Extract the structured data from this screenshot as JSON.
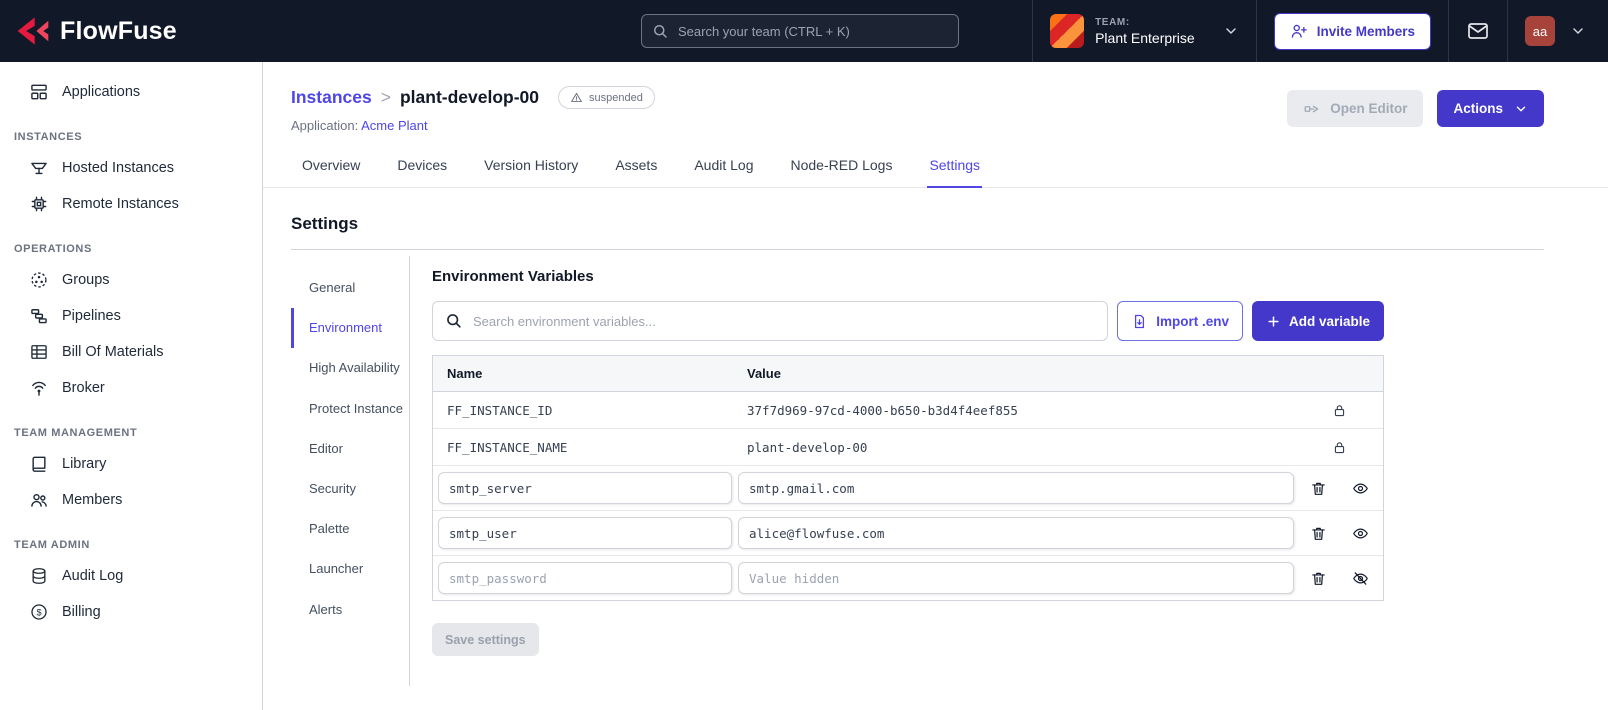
{
  "theme": {
    "header-bg": "#111827",
    "accent": "#4338ca",
    "link": "#4f46e5",
    "brand-red": "#e51a3f",
    "avatar-bg": "#a8433c"
  },
  "header": {
    "brand": "FlowFuse",
    "search_placeholder": "Search your team (CTRL + K)",
    "team_label": "TEAM:",
    "team_name": "Plant Enterprise",
    "invite_label": "Invite Members",
    "avatar": "aa"
  },
  "sidebar": {
    "sections": [
      {
        "label": "",
        "items": [
          "Applications"
        ]
      },
      {
        "label": "INSTANCES",
        "items": [
          "Hosted Instances",
          "Remote Instances"
        ]
      },
      {
        "label": "OPERATIONS",
        "items": [
          "Groups",
          "Pipelines",
          "Bill Of Materials",
          "Broker"
        ]
      },
      {
        "label": "TEAM MANAGEMENT",
        "items": [
          "Library",
          "Members"
        ]
      },
      {
        "label": "TEAM ADMIN",
        "items": [
          "Audit Log",
          "Billing"
        ]
      }
    ]
  },
  "main": {
    "breadcrumb_parent": "Instances",
    "breadcrumb_separator": ">",
    "instance_name": "plant-develop-00",
    "status_badge": "suspended",
    "application_label": "Application:",
    "application_name": "Acme Plant",
    "open_editor_label": "Open Editor",
    "actions_label": "Actions",
    "tabs": [
      "Overview",
      "Devices",
      "Version History",
      "Assets",
      "Audit Log",
      "Node-RED Logs",
      "Settings"
    ],
    "active_tab": "Settings",
    "settings_title": "Settings",
    "settings_nav": [
      "General",
      "Environment",
      "High Availability",
      "Protect Instance",
      "Editor",
      "Security",
      "Palette",
      "Launcher",
      "Alerts"
    ],
    "active_settings_nav": "Environment"
  },
  "env": {
    "title": "Environment Variables",
    "search_placeholder": "Search environment variables...",
    "import_label": "Import .env",
    "add_label": "Add variable",
    "headers": {
      "name": "Name",
      "value": "Value"
    },
    "locked_rows": [
      {
        "name": "FF_INSTANCE_ID",
        "value": "37f7d969-97cd-4000-b650-b3d4f4eef855"
      },
      {
        "name": "FF_INSTANCE_NAME",
        "value": "plant-develop-00"
      }
    ],
    "rows": [
      {
        "name": "smtp_server",
        "value": "smtp.gmail.com",
        "hidden": false
      },
      {
        "name": "smtp_user",
        "value": "alice@flowfuse.com",
        "hidden": false
      },
      {
        "name": "smtp_password",
        "value_placeholder": "Value hidden",
        "hidden": true
      }
    ],
    "save_label": "Save settings"
  }
}
